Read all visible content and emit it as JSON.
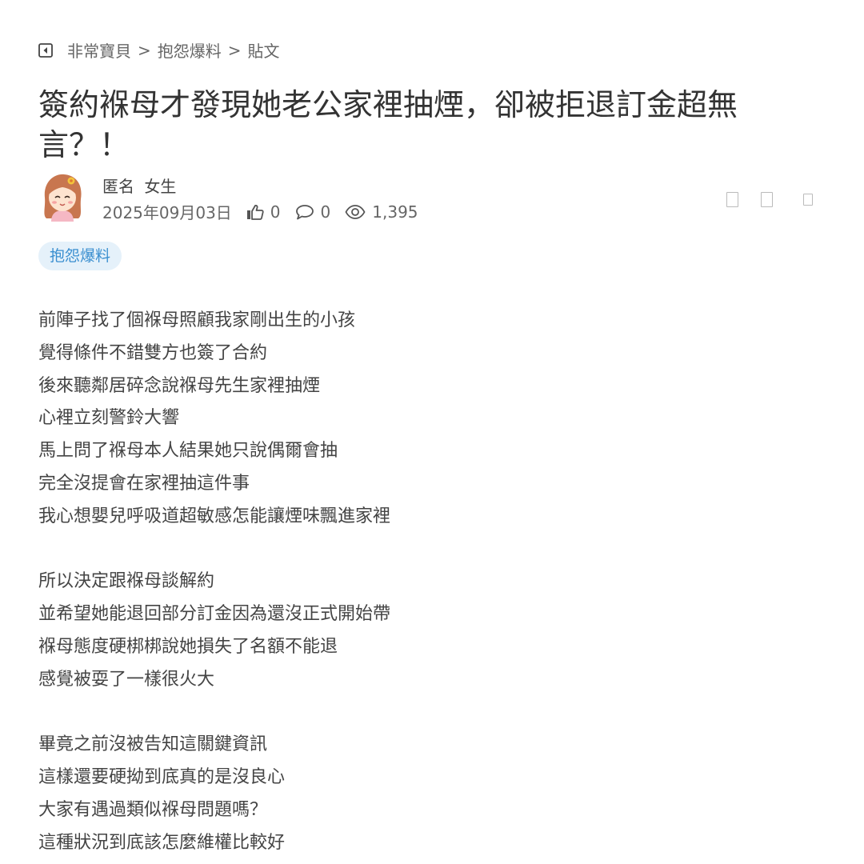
{
  "breadcrumb": {
    "items": [
      "非常寶貝",
      "抱怨爆料",
      "貼文"
    ],
    "separator": ">"
  },
  "post": {
    "title": "簽約褓母才發現她老公家裡抽煙，卻被拒退訂金超無言？！",
    "author": {
      "name": "匿名",
      "gender": "女生"
    },
    "date": "2025年09月03日",
    "likes": "0",
    "comments": "0",
    "views": "1,395",
    "tag": "抱怨爆料",
    "paragraphs": [
      [
        "前陣子找了個褓母照顧我家剛出生的小孩",
        "覺得條件不錯雙方也簽了合約",
        "後來聽鄰居碎念說褓母先生家裡抽煙",
        "心裡立刻警鈴大響",
        "馬上問了褓母本人結果她只說偶爾會抽",
        "完全沒提會在家裡抽這件事",
        "我心想嬰兒呼吸道超敏感怎能讓煙味飄進家裡"
      ],
      [
        "所以決定跟褓母談解約",
        "並希望她能退回部分訂金因為還沒正式開始帶",
        "褓母態度硬梆梆說她損失了名額不能退",
        "感覺被耍了一樣很火大"
      ],
      [
        "畢竟之前沒被告知這關鍵資訊",
        "這樣還要硬拗到底真的是沒良心",
        "大家有遇過類似褓母問題嗎？",
        "這種狀況到底該怎麼維權比較好"
      ]
    ]
  },
  "colors": {
    "tag_bg": "#e5f1fa",
    "tag_text": "#3a8fd0",
    "text": "#444444"
  }
}
